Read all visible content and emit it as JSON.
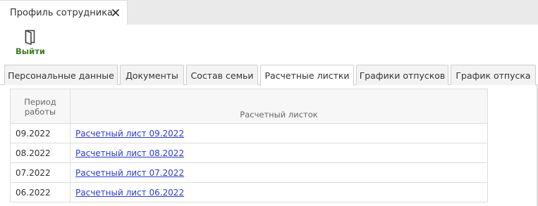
{
  "window_tab": {
    "title": "Профиль сотрудника",
    "close_icon": "close-icon"
  },
  "toolbar": {
    "exit_label": "Выйти",
    "exit_icon": "door-exit-icon",
    "exit_color": "#3f7d27"
  },
  "tabs": [
    {
      "label": "Персональные данные",
      "active": false
    },
    {
      "label": "Документы",
      "active": false
    },
    {
      "label": "Состав семьи",
      "active": false
    },
    {
      "label": "Расчетные листки",
      "active": true
    },
    {
      "label": "Графики отпусков",
      "active": false
    },
    {
      "label": "График отпуска",
      "active": false
    }
  ],
  "grid": {
    "columns": {
      "period": "Период работы",
      "sheet": "Расчетный листок"
    },
    "rows": [
      {
        "period": "09.2022",
        "link": "Расчетный лист 09.2022"
      },
      {
        "period": "08.2022",
        "link": "Расчетный лист 08.2022"
      },
      {
        "period": "07.2022",
        "link": "Расчетный лист 07.2022"
      },
      {
        "period": "06.2022",
        "link": "Расчетный лист 06.2022"
      }
    ]
  },
  "colors": {
    "link": "#2b3bd1",
    "accent_green": "#3f7d27",
    "border": "#dddddd"
  }
}
